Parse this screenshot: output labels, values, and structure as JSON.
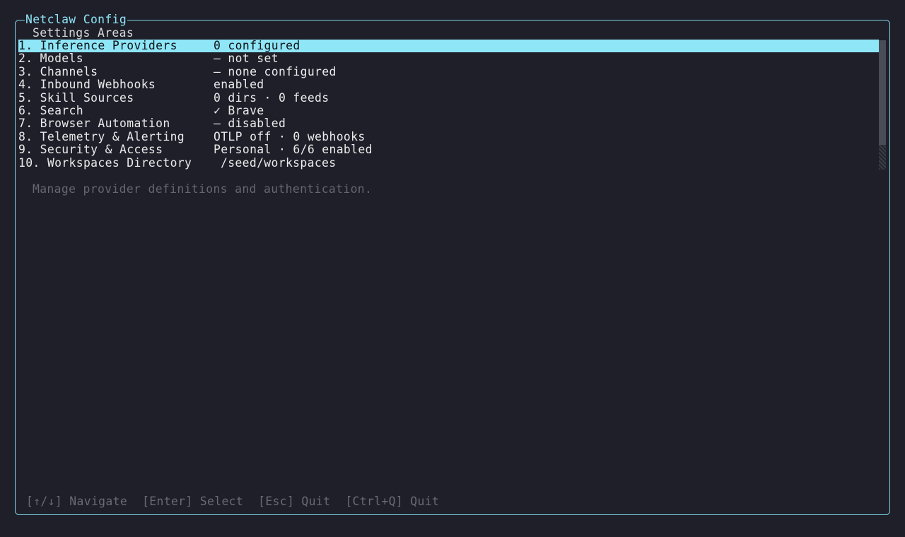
{
  "app": {
    "title": "Netclaw Config"
  },
  "settings": {
    "heading": "Settings Areas",
    "items": [
      {
        "label": "1. Inference Providers",
        "value": "0 configured",
        "selected": true
      },
      {
        "label": "2. Models",
        "value": "— not set"
      },
      {
        "label": "3. Channels",
        "value": "— none configured"
      },
      {
        "label": "4. Inbound Webhooks",
        "value": "enabled"
      },
      {
        "label": "5. Skill Sources",
        "value": "0 dirs · 0 feeds"
      },
      {
        "label": "6. Search",
        "value": "✓ Brave"
      },
      {
        "label": "7. Browser Automation",
        "value": "— disabled"
      },
      {
        "label": "8. Telemetry & Alerting",
        "value": "OTLP off · 0 webhooks"
      },
      {
        "label": "9. Security & Access",
        "value": "Personal · 6/6 enabled"
      },
      {
        "label": "10. Workspaces Directory",
        "value": "/seed/workspaces"
      }
    ],
    "description": "Manage provider definitions and authentication."
  },
  "footer": {
    "hints": [
      "[↑/↓] Navigate",
      "[Enter] Select",
      "[Esc] Quit",
      "[Ctrl+Q] Quit"
    ]
  },
  "colors": {
    "background": "#1e1f29",
    "border": "#7fd3e6",
    "selection": "#8ee6f7",
    "muted_text": "#686a74"
  }
}
